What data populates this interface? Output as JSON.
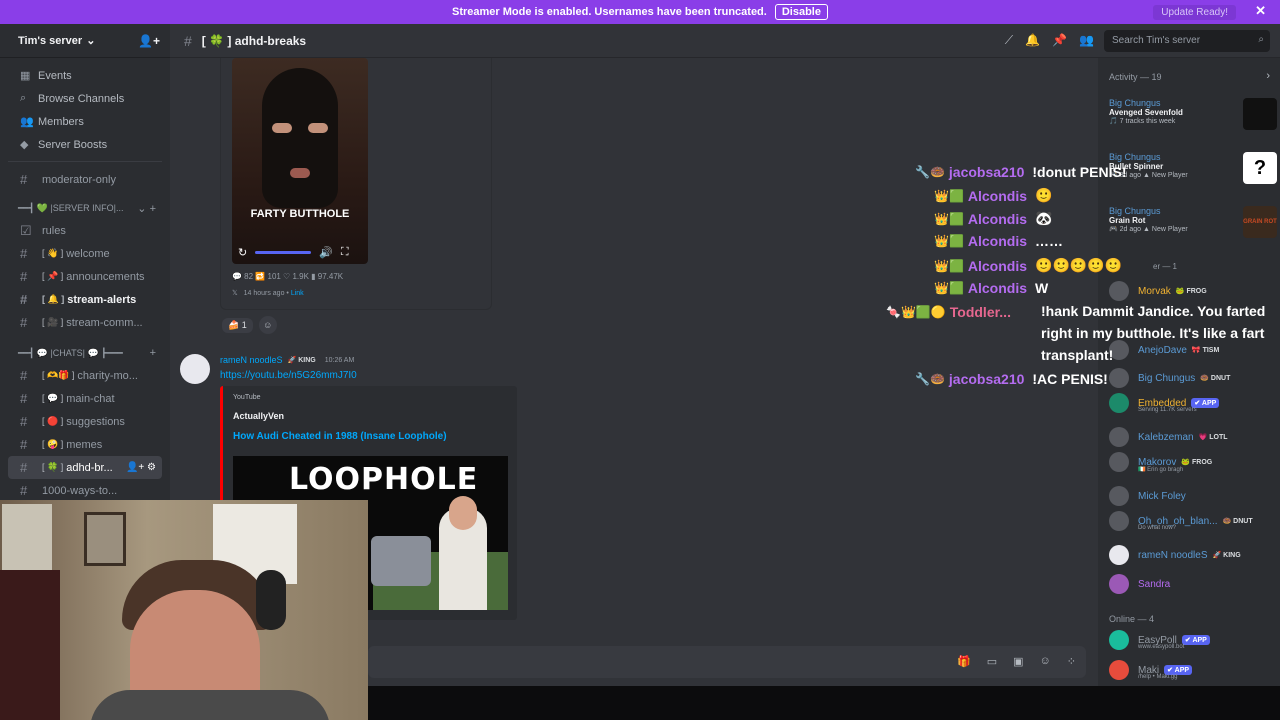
{
  "banner": {
    "text": "Streamer Mode is enabled. Usernames have been truncated.",
    "disable": "Disable",
    "update": "Update Ready!",
    "close": "✕"
  },
  "server": {
    "name": "Tim's server",
    "chev": "⌄",
    "add": "👤+"
  },
  "nav": [
    {
      "icon": "▦",
      "label": "Events"
    },
    {
      "icon": "⌕",
      "label": "Browse Channels"
    },
    {
      "icon": "👥",
      "label": "Members"
    },
    {
      "icon": "◆",
      "label": "Server Boosts"
    }
  ],
  "channels": {
    "mod": "moderator-only",
    "cat1": "━━┫ 💚 |SERVER INFO|...",
    "rules": "rules",
    "welcome": "welcome",
    "announcements": "announcements",
    "alerts": "stream-alerts",
    "comm": "stream-comm...",
    "cat2": "━━┫ 💬 |CHATS| 💬 ┣━━━",
    "charity": "charity-mo...",
    "main": "main-chat",
    "suggestions": "suggestions",
    "memes": "memes",
    "adhd": "adhd-br...",
    "cut": "1000-ways-to..."
  },
  "topbar": {
    "hash": "#",
    "name": "[ 🍀 ] adhd-breaks",
    "search": "Search Tim's server"
  },
  "tweet": {
    "caption": "FARTY BUTTHOLE",
    "stats": "💬 82  🔁 101  ♡ 1.9K  ▮ 97.47K",
    "ago": "14 hours ago",
    "link": "Link",
    "reaction_count": "1",
    "x": "𝕏"
  },
  "message": {
    "user": "rameN noodleS",
    "tag": "🚀 KING",
    "time": "10:26 AM",
    "link": "https://youtu.be/n5G26mmJ7I0"
  },
  "embed": {
    "provider": "YouTube",
    "author": "ActuallyVen",
    "title": "How Audi Cheated in 1988 (Insane Loophole)",
    "thumb_text": "LOOPHOLE"
  },
  "activity": {
    "header": "Activity — 19",
    "arrow": "›",
    "items": [
      {
        "who": "Big Chungus",
        "what": "Avenged Sevenfold",
        "sub": "🎵 7 tracks this week"
      },
      {
        "who": "Big Chungus",
        "what": "Bullet Spinner",
        "sub": "🎮 3d ago  ▲ New Player"
      },
      {
        "who": "Big Chungus",
        "what": "Grain Rot",
        "sub": "🎮 2d ago  ▲ New Player"
      }
    ]
  },
  "group_frag": "er — 1",
  "members": [
    {
      "name": "Morvak",
      "badge": "🐸 FROG",
      "color": "#f0b232"
    },
    {
      "name": "AnejoDave",
      "badge": "🎀 TISM",
      "color": "#5b9bd5"
    },
    {
      "name": "Big Chungus",
      "badge": "🍩 DNUT",
      "color": "#5b9bd5"
    },
    {
      "name": "Embedded",
      "badge": "✔ APP",
      "color": "#f0b232",
      "sub": "Serving 11.7K servers"
    },
    {
      "name": "Kalebzeman",
      "badge": "💗 LOTL",
      "color": "#5b9bd5"
    },
    {
      "name": "Makorov",
      "badge": "🐸 FROG",
      "color": "#5b9bd5",
      "sub": "🇮🇪 Erin go bragh"
    },
    {
      "name": "Mick Foley",
      "badge": "",
      "color": "#5b9bd5"
    },
    {
      "name": "Oh_oh_oh_blan...",
      "badge": "🍩 DNUT",
      "color": "#5b9bd5",
      "sub": "Do what now?"
    },
    {
      "name": "rameN noodleS",
      "badge": "🚀 KING",
      "color": "#5b9bd5"
    },
    {
      "name": "Sandra",
      "badge": "",
      "color": "#b46cf0"
    }
  ],
  "online": {
    "header": "Online — 4",
    "items": [
      {
        "name": "EasyPoll",
        "badge": "✔ APP",
        "sub": "www.easypoll.bot"
      },
      {
        "name": "Maki",
        "badge": "✔ APP",
        "sub": "/help • Maki.gg"
      }
    ]
  },
  "chat_overlay": [
    {
      "name": "jacobsa210",
      "text": "!donut PENIS!",
      "kind": "purple"
    },
    {
      "name": "Alcondis",
      "text": "🙂",
      "kind": "purple"
    },
    {
      "name": "Alcondis",
      "text": "🐼",
      "kind": "purple"
    },
    {
      "name": "Alcondis",
      "text": "……",
      "kind": "purple"
    },
    {
      "name": "Alcondis",
      "text": "🙂🙂🙂🙂🙂",
      "kind": "purple"
    },
    {
      "name": "Alcondis",
      "text": "W",
      "kind": "purple"
    },
    {
      "name": "Toddler...",
      "text": "",
      "kind": "pink"
    },
    {
      "name": "jacobsa210",
      "text": "!AC PENIS!",
      "kind": "purple"
    }
  ],
  "overlay_multiline": "!hank Dammit Jandice. You farted right in my butthole. It's like a fart transplant!",
  "colors": {
    "blurple": "#5865f2",
    "banner": "#8a3ee8",
    "accent_link": "#00a8fc"
  }
}
